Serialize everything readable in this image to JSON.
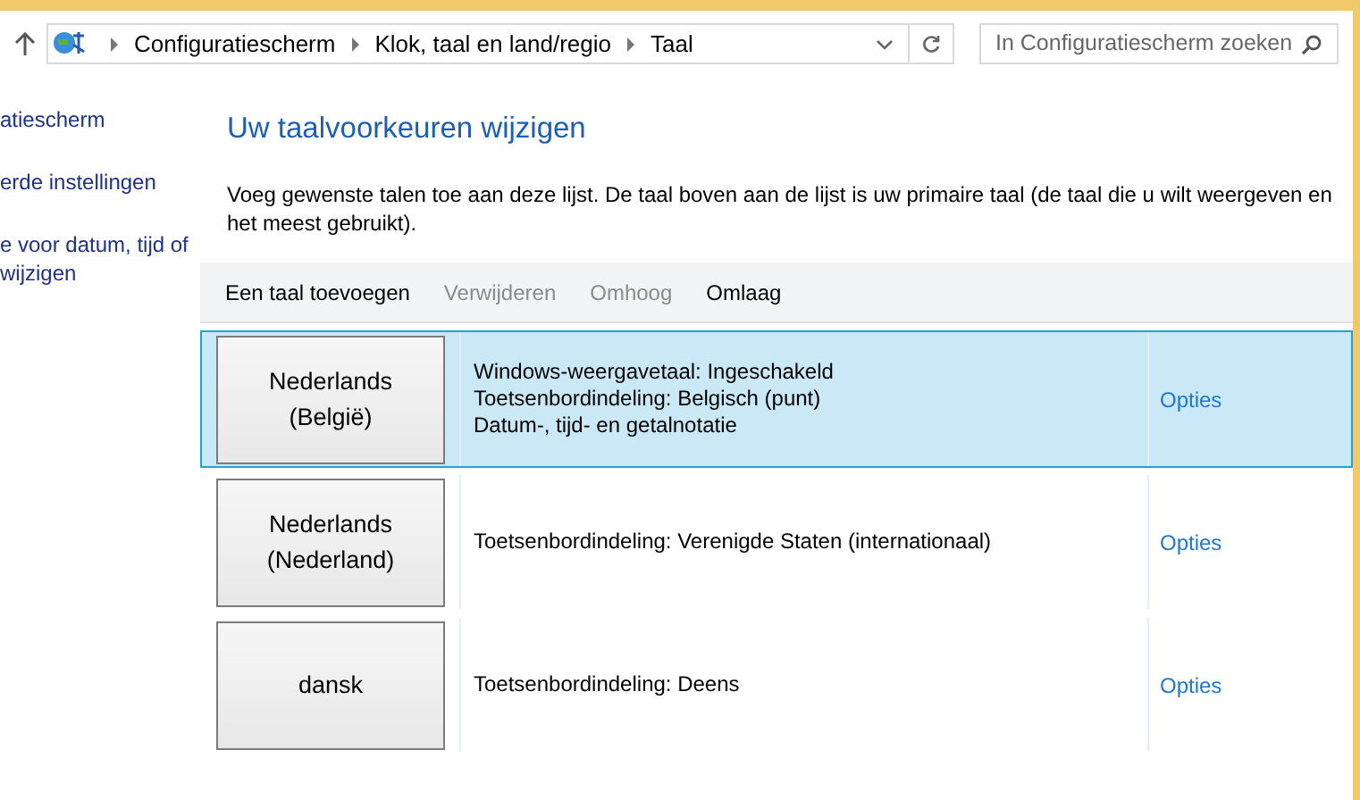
{
  "address_bar": {
    "breadcrumbs": [
      "Configuratiescherm",
      "Klok, taal en land/regio",
      "Taal"
    ]
  },
  "search": {
    "placeholder": "In Configuratiescherm zoeken"
  },
  "sidebar": {
    "items": [
      "atiescherm",
      "erde instellingen",
      "e voor datum, tijd of wijzigen"
    ]
  },
  "heading": "Uw taalvoorkeuren wijzigen",
  "description": "Voeg gewenste talen toe aan deze lijst. De taal boven aan de lijst is uw primaire taal (de taal die u wilt weergeven en het meest gebruikt).",
  "toolbar": [
    {
      "label": "Een taal toevoegen",
      "disabled": false
    },
    {
      "label": "Verwijderen",
      "disabled": true
    },
    {
      "label": "Omhoog",
      "disabled": true
    },
    {
      "label": "Omlaag",
      "disabled": false
    }
  ],
  "languages": [
    {
      "name": "Nederlands (België)",
      "selected": true,
      "details": [
        "Windows-weergavetaal: Ingeschakeld",
        "Toetsenbordindeling: Belgisch (punt)",
        "Datum-, tijd- en getalnotatie"
      ],
      "options": "Opties"
    },
    {
      "name": "Nederlands (Nederland)",
      "selected": false,
      "details": [
        "Toetsenbordindeling: Verenigde Staten (internationaal)"
      ],
      "options": "Opties"
    },
    {
      "name": "dansk",
      "selected": false,
      "details": [
        "Toetsenbordindeling: Deens"
      ],
      "options": "Opties"
    }
  ]
}
